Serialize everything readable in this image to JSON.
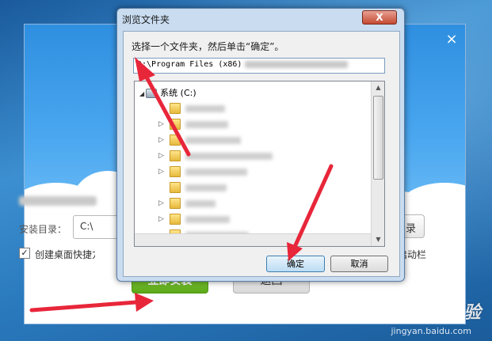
{
  "installer": {
    "close_label": "×",
    "dir_label": "安装目录：",
    "dir_value": "C:\\",
    "change_dir_label": "更改目录",
    "desktop_shortcut_label": "创建桌面快捷方式",
    "desktop_shortcut_checked": true,
    "desktop_shortcut_mark": "✓",
    "quicklaunch_label": "添加到快速启动栏",
    "install_button": "立即安装",
    "back_button": "返回"
  },
  "dialog": {
    "title": "浏览文件夹",
    "close_label": "X",
    "prompt": "选择一个文件夹，然后单击“确定”。",
    "path_value": "D:\\Program Files (x86)",
    "tree_root_arrow": "◢",
    "tree_root_label": "系统 (C:)",
    "tree_expand_arrow": "▷",
    "ok_button": "确定",
    "cancel_button": "取消",
    "scroll_up": "▲",
    "scroll_down": "▼"
  },
  "watermark": {
    "brand": "Baidu 经验",
    "site": "jingyan.baidu.com"
  },
  "colors": {
    "annotation_red": "#e8263a",
    "install_green": "#6fbb27",
    "dialog_frame": "#c9dcf0"
  }
}
